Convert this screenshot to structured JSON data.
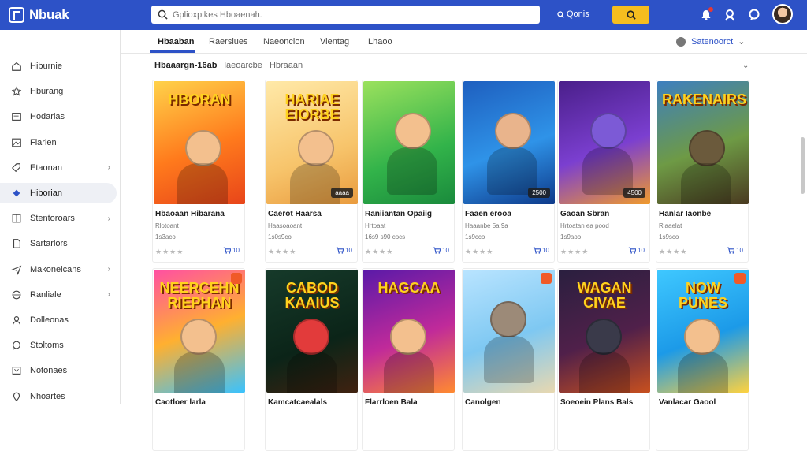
{
  "app": {
    "brand": "Nbuak",
    "search": {
      "value": "",
      "placeholder": "Gplioxpikes Hboaenah."
    },
    "search_option": "Qonis",
    "accent_color": "#2d52c7",
    "search_button_color": "#f5bd1f",
    "top_icons": [
      "bell-icon",
      "search-icon",
      "chat-icon",
      "avatar"
    ]
  },
  "sidebar": {
    "items": [
      {
        "label": "Hiburnie",
        "icon": "home-icon",
        "chevron": false,
        "active": false
      },
      {
        "label": "Hburang",
        "icon": "star-icon",
        "chevron": false,
        "active": false
      },
      {
        "label": "Hodarias",
        "icon": "card-icon",
        "chevron": false,
        "active": false
      },
      {
        "label": "Flarien",
        "icon": "image-icon",
        "chevron": false,
        "active": false
      },
      {
        "label": "Etaonan",
        "icon": "tag-icon",
        "chevron": true,
        "active": false
      },
      {
        "label": "Hiborian",
        "icon": "diamond-icon",
        "chevron": false,
        "active": true
      },
      {
        "label": "Stentoroars",
        "icon": "grid-icon",
        "chevron": true,
        "active": false
      },
      {
        "label": "Sartarlors",
        "icon": "doc-icon",
        "chevron": false,
        "active": false
      },
      {
        "label": "Makonelcans",
        "icon": "send-icon",
        "chevron": true,
        "active": false
      },
      {
        "label": "Ranliale",
        "icon": "globe-icon",
        "chevron": true,
        "active": false
      },
      {
        "label": "Dolleonas",
        "icon": "user-icon",
        "chevron": false,
        "active": false
      },
      {
        "label": "Stoltoms",
        "icon": "chat-icon",
        "chevron": false,
        "active": false
      },
      {
        "label": "Notonaes",
        "icon": "box-icon",
        "chevron": false,
        "active": false
      },
      {
        "label": "Nhoartes",
        "icon": "pin-icon",
        "chevron": false,
        "active": false
      }
    ]
  },
  "tabs": [
    {
      "label": "Hbaaban",
      "active": true
    },
    {
      "label": "Raerslues",
      "active": false
    },
    {
      "label": "Naeoncion",
      "active": false
    },
    {
      "label": "Vientag",
      "active": false
    },
    {
      "label": "Lhaoo",
      "active": false
    }
  ],
  "sort": {
    "label": "Satenoorct"
  },
  "section": {
    "title": "Hbaaargn-16ab",
    "subtitle": "laeoarcbe",
    "extra": "Hbraaan"
  },
  "cards": [
    {
      "title": "Hbaoaan Hibarana",
      "sub": "Rlotoant",
      "meta": "1s3aco",
      "price": "",
      "rating": "10",
      "art": "HBORAN",
      "theme": "orange"
    },
    {
      "title": "Caerot Haarsa",
      "sub": "Haasoaoant",
      "meta": "1s0s9co",
      "price": "aaaa",
      "rating": "10",
      "art": "HARIAE EIORBE",
      "theme": "purple"
    },
    {
      "title": "Raniiantan Opaiig",
      "sub": "Hrtoaat",
      "meta": "16s9 s90 cocs",
      "price": "",
      "rating": "10",
      "art": "",
      "theme": "green"
    },
    {
      "title": "Faaen erooa",
      "sub": "Haaanbe 5a 9a",
      "meta": "1s9cco",
      "price": "2500",
      "rating": "10",
      "art": "",
      "theme": "blue"
    },
    {
      "title": "Gaoan Sbran",
      "sub": "Hrtoatan ea pood",
      "meta": "1s9aoo",
      "price": "4500",
      "rating": "10",
      "art": "",
      "theme": "violet"
    },
    {
      "title": "Hanlar Iaonbe",
      "sub": "Rlaaelat",
      "meta": "1s9sco",
      "price": "",
      "rating": "10",
      "art": "RAKENAIRS",
      "theme": "earth"
    },
    {
      "title": "Caotloer larla",
      "sub": "",
      "meta": "",
      "price": "",
      "rating": "",
      "art": "NEERCEHN RIEPHAN",
      "theme": "rainbow"
    },
    {
      "title": "Kamcatcaealals",
      "sub": "",
      "meta": "",
      "price": "",
      "rating": "",
      "art": "CABOD KAAIUS",
      "theme": "dark"
    },
    {
      "title": "Flarrloen Bala",
      "sub": "",
      "meta": "",
      "price": "",
      "rating": "",
      "art": "HAGCAA",
      "theme": "magenta"
    },
    {
      "title": "Canolgen",
      "sub": "",
      "meta": "",
      "price": "",
      "rating": "",
      "art": "",
      "theme": "sky"
    },
    {
      "title": "Soeoein Plans Bals",
      "sub": "",
      "meta": "",
      "price": "",
      "rating": "",
      "art": "WAGAN CIVAE",
      "theme": "night"
    },
    {
      "title": "Vanlacar Gaool",
      "sub": "",
      "meta": "",
      "price": "",
      "rating": "",
      "art": "NOW PUNES",
      "theme": "cyan"
    }
  ]
}
